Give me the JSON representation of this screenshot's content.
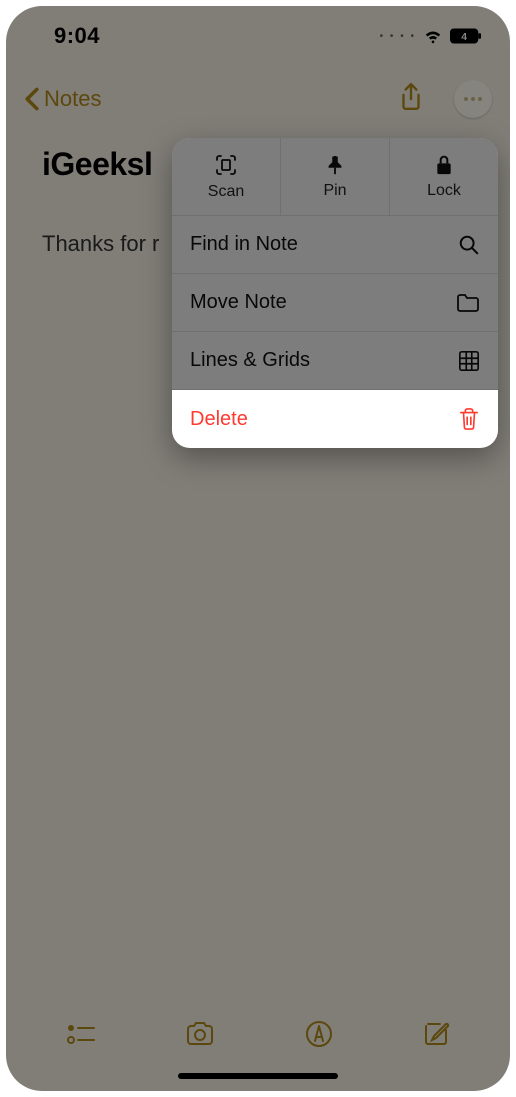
{
  "status": {
    "time": "9:04"
  },
  "nav": {
    "back_label": "Notes"
  },
  "note": {
    "title_visible": "iGeeksl",
    "body_visible": "Thanks for r"
  },
  "sheet": {
    "top": [
      {
        "label": "Scan",
        "icon": "scan-icon"
      },
      {
        "label": "Pin",
        "icon": "pin-icon"
      },
      {
        "label": "Lock",
        "icon": "lock-icon"
      }
    ],
    "items": [
      {
        "label": "Find in Note",
        "icon": "search-icon",
        "destructive": false
      },
      {
        "label": "Move Note",
        "icon": "folder-icon",
        "destructive": false
      },
      {
        "label": "Lines & Grids",
        "icon": "grid-icon",
        "destructive": false
      },
      {
        "label": "Delete",
        "icon": "trash-icon",
        "destructive": true
      }
    ]
  },
  "colors": {
    "accent": "#b08a1a",
    "destructive": "#ff3b30",
    "sheet_bg": "#f0f0f2"
  }
}
